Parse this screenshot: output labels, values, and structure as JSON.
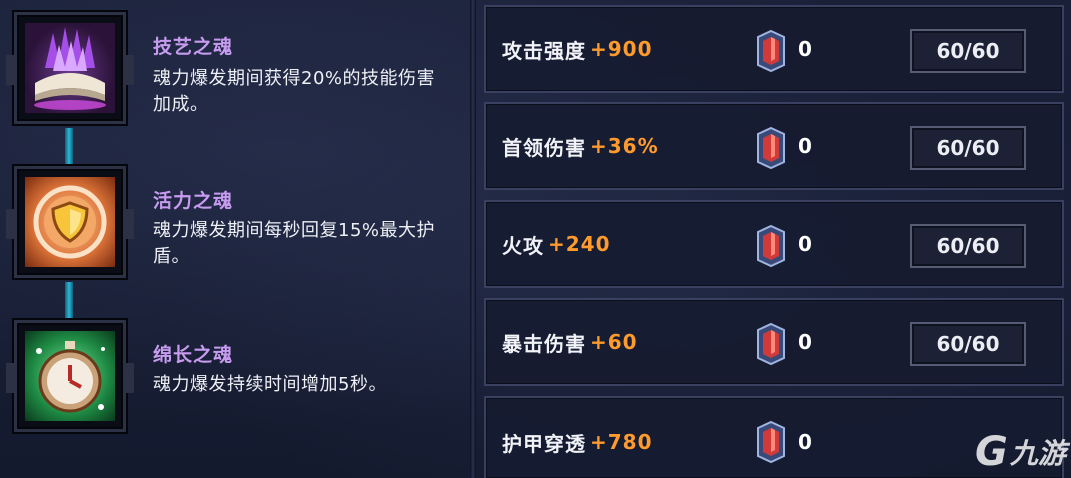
{
  "skills": [
    {
      "name": "技艺之魂",
      "name_color": "#c79cf0",
      "desc": "魂力爆发期间获得20%的技能伤害加成。",
      "icon": "spellbook-icon"
    },
    {
      "name": "活力之魂",
      "name_color": "#c79cf0",
      "desc": "魂力爆发期间每秒回复15%最大护盾。",
      "icon": "shield-icon"
    },
    {
      "name": "绵长之魂",
      "name_color": "#c79cf0",
      "desc": "魂力爆发持续时间增加5秒。",
      "icon": "stopwatch-icon"
    }
  ],
  "stats": [
    {
      "label": "攻击强度",
      "bonus": "+900",
      "gem_count": "0",
      "cap": "60/60"
    },
    {
      "label": "首领伤害",
      "bonus": "+36%",
      "gem_count": "0",
      "cap": "60/60"
    },
    {
      "label": "火攻",
      "bonus": "+240",
      "gem_count": "0",
      "cap": "60/60"
    },
    {
      "label": "暴击伤害",
      "bonus": "+60",
      "gem_count": "0",
      "cap": "60/60"
    },
    {
      "label": "护甲穿透",
      "bonus": "+780",
      "gem_count": "0",
      "cap": ""
    }
  ],
  "watermark": {
    "symbol": "G",
    "text": "九游"
  },
  "colors": {
    "bonus": "#ff9a2c",
    "skill_name": "#c79cf0",
    "connector": "#2bb7d6"
  }
}
